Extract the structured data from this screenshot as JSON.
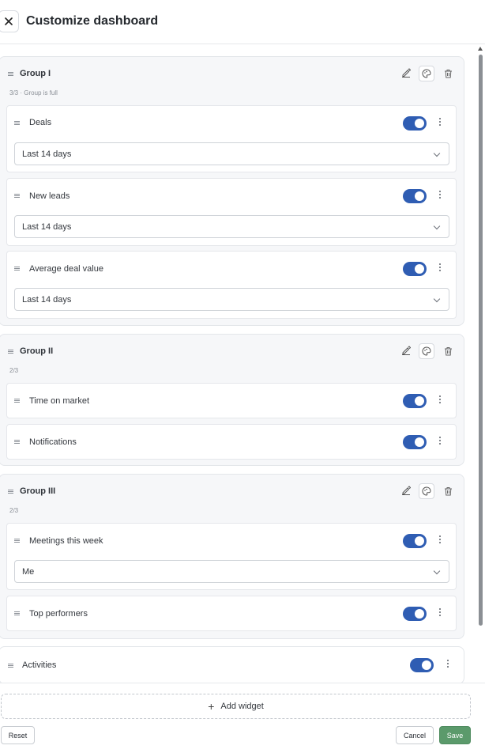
{
  "header": {
    "title": "Customize dashboard",
    "close_icon": "close-icon"
  },
  "groups": [
    {
      "title": "Group I",
      "subtitle": "3/3 · Group is full",
      "widgets": [
        {
          "label": "Deals",
          "enabled": true,
          "select": "Last 14 days"
        },
        {
          "label": "New leads",
          "enabled": true,
          "select": "Last 14 days"
        },
        {
          "label": "Average deal value",
          "enabled": true,
          "select": "Last 14 days"
        }
      ]
    },
    {
      "title": "Group II",
      "subtitle": "2/3",
      "widgets": [
        {
          "label": "Time on market",
          "enabled": true
        },
        {
          "label": "Notifications",
          "enabled": true
        }
      ]
    },
    {
      "title": "Group III",
      "subtitle": "2/3",
      "widgets": [
        {
          "label": "Meetings this week",
          "enabled": true,
          "select": "Me"
        },
        {
          "label": "Top performers",
          "enabled": true
        }
      ]
    }
  ],
  "standalone": [
    {
      "label": "Activities",
      "enabled": true
    }
  ],
  "footer": {
    "add_widget": "Add widget",
    "reset": "Reset",
    "cancel": "Cancel",
    "save": "Save"
  },
  "colors": {
    "toggle_on": "#2f5db3",
    "save": "#5b9a6b",
    "group_bg": "#f6f7f9"
  }
}
